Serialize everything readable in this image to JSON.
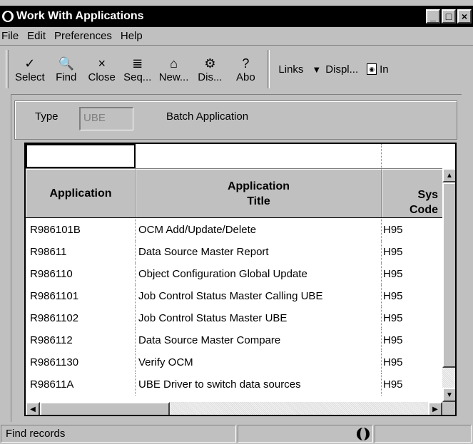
{
  "window": {
    "title": "Work With Applications",
    "min": "_",
    "max": "□",
    "close": "×"
  },
  "menu": [
    "File",
    "Edit",
    "Preferences",
    "Help"
  ],
  "toolbar": {
    "buttons": [
      {
        "label": "Select",
        "icon": "check-icon",
        "glyph": "✓"
      },
      {
        "label": "Find",
        "icon": "find-icon",
        "glyph": "🔍"
      },
      {
        "label": "Close",
        "icon": "close-icon",
        "glyph": "×"
      },
      {
        "label": "Seq...",
        "icon": "sequence-icon",
        "glyph": "≣"
      },
      {
        "label": "New...",
        "icon": "new-icon",
        "glyph": "⌂"
      },
      {
        "label": "Dis...",
        "icon": "display-icon",
        "glyph": "⚙"
      },
      {
        "label": "Abo",
        "icon": "about-icon",
        "glyph": "?"
      }
    ],
    "links_label": "Links",
    "display_label": "Displ...",
    "in_label": "In"
  },
  "filter": {
    "type_label": "Type",
    "type_value": "UBE",
    "type_description": "Batch Application"
  },
  "grid": {
    "headers": [
      "Application",
      "Application\nTitle",
      "Sys\nCode"
    ],
    "rows": [
      [
        "R986101B",
        "OCM Add/Update/Delete",
        "H95"
      ],
      [
        "R98611",
        "Data Source Master Report",
        "H95"
      ],
      [
        "R986110",
        "Object Configuration Global Update",
        "H95"
      ],
      [
        "R9861101",
        "Job Control Status Master Calling UBE",
        "H95"
      ],
      [
        "R9861102",
        "Job Control Status Master UBE",
        "H95"
      ],
      [
        "R986112",
        "Data Source Master Compare",
        "H95"
      ],
      [
        "R9861130",
        "Verify OCM",
        "H95"
      ],
      [
        "R98611A",
        "UBE Driver to switch data sources",
        "H95"
      ]
    ]
  },
  "status": {
    "text": "Find records"
  },
  "colors": {
    "titlebar": "#000000",
    "chrome": "#c0c0c0",
    "grid_bg": "#ffffff"
  }
}
